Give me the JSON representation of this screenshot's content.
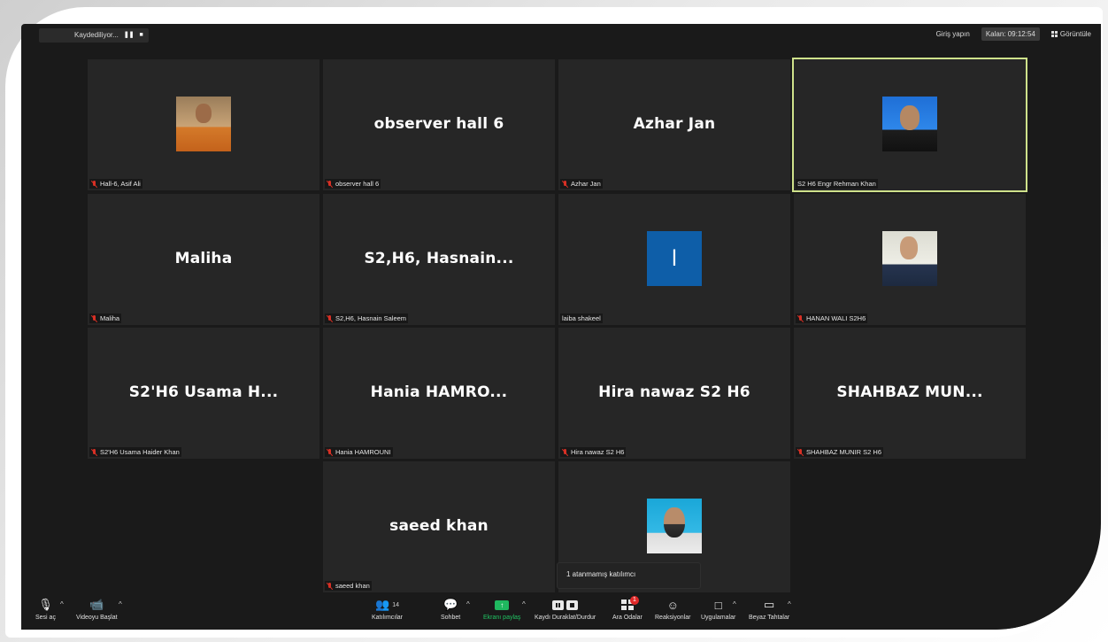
{
  "top_bar": {
    "recording_label": "Kaydediliyor...",
    "pause_glyph": "❚❚",
    "stop_glyph": "■",
    "signin_label": "Giriş yapın",
    "time_label": "Kalan: 09:12:54",
    "view_label": "Görüntüle"
  },
  "tiles": [
    {
      "display": "",
      "caption": "Hall-6, Asif Ali",
      "muted": true,
      "avatar": "photo-man-orange"
    },
    {
      "display": "observer hall 6",
      "caption": "observer hall 6",
      "muted": true
    },
    {
      "display": "Azhar Jan",
      "caption": "Azhar Jan",
      "muted": true
    },
    {
      "display": "",
      "caption": "S2 H6 Engr Rehman Khan",
      "muted": false,
      "active": true,
      "avatar": "photo-man-blue"
    },
    {
      "display": "Maliha",
      "caption": "Maliha",
      "muted": true
    },
    {
      "display": "S2,H6,  Hasnain...",
      "caption": "S2,H6, Hasnain Saleem",
      "muted": true
    },
    {
      "display": "",
      "caption": "laiba shakeel",
      "muted": false,
      "avatar_letter": "l"
    },
    {
      "display": "",
      "caption": "HANAN WALI S2H6",
      "muted": true,
      "avatar": "photo-man-white"
    },
    {
      "display": "S2'H6  Usama  H...",
      "caption": "S2'H6 Usama Haider Khan",
      "muted": true
    },
    {
      "display": "Hania   HAMRO...",
      "caption": "Hania  HAMROUNI",
      "muted": true
    },
    {
      "display": "Hira nawaz S2 H6",
      "caption": "Hira nawaz S2 H6",
      "muted": true
    },
    {
      "display": "SHAHBAZ  MUN...",
      "caption": "SHAHBAZ MUNIR S2 H6",
      "muted": true
    },
    {
      "display": "saeed khan",
      "caption": "saeed khan",
      "muted": true
    },
    {
      "display": "",
      "caption": "",
      "muted": false,
      "avatar": "photo-man-cyan"
    }
  ],
  "popup": {
    "text": "1 atanmamış katılımcı"
  },
  "toolbar": {
    "audio_label": "Sesi aç",
    "video_label": "Videoyu Başlat",
    "participants_label": "Katılımcılar",
    "participants_count": "14",
    "chat_label": "Sohbet",
    "share_label": "Ekranı paylaş",
    "record_label": "Kaydı Duraklat/Durdur",
    "breakout_label": "Ara Odalar",
    "breakout_badge": "1",
    "reactions_label": "Reaksiyonlar",
    "apps_label": "Uygulamalar",
    "whiteboard_label": "Beyaz Tahtalar"
  },
  "colors": {
    "active_speaker_border": "#cfe28b",
    "share_green": "#20c463",
    "mute_red": "#d93025",
    "badge_red": "#e02828",
    "accent_blue": "#2d8cff"
  }
}
